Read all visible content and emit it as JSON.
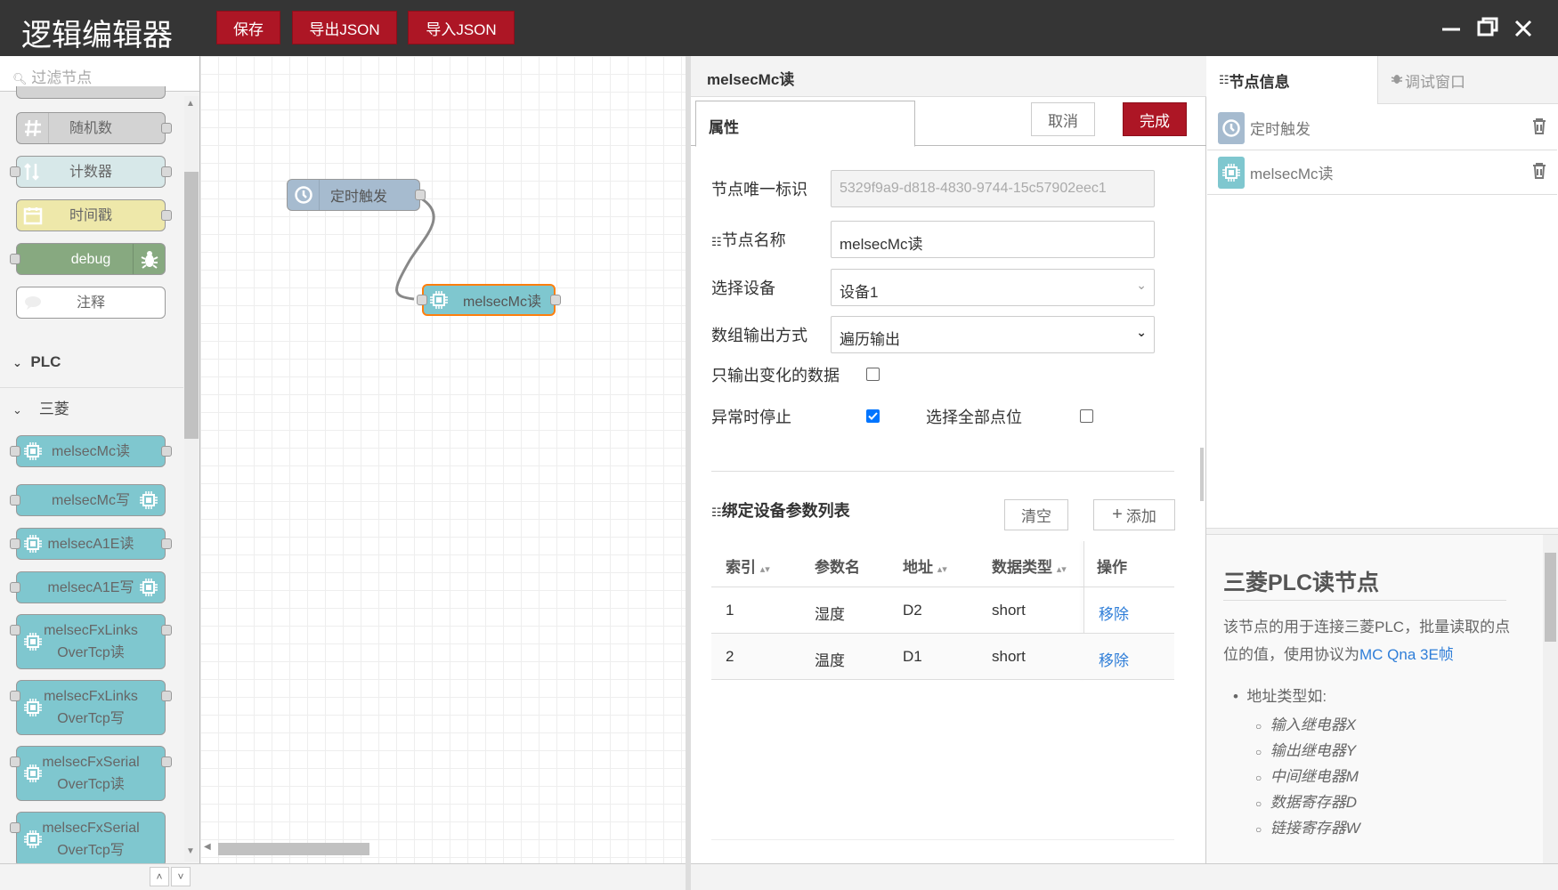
{
  "header": {
    "title": "逻辑编辑器",
    "save_label": "保存",
    "export_label": "导出JSON",
    "import_label": "导入JSON"
  },
  "palette": {
    "filter_placeholder": "过滤节点",
    "common_nodes": [
      {
        "label": "随机数",
        "icon": "hash-icon",
        "color": "#d3d3d3"
      },
      {
        "label": "计数器",
        "icon": "counter-icon",
        "color": "#d7e8e9"
      },
      {
        "label": "时间戳",
        "icon": "calendar-icon",
        "color": "#eee8aa"
      },
      {
        "label": "debug",
        "icon": "bug-icon",
        "color": "#87a980"
      },
      {
        "label": "注释",
        "icon": "comment-icon",
        "color": "#ffffff"
      }
    ],
    "category_plc": "PLC",
    "category_mitsubishi": "三菱",
    "plc_nodes": [
      {
        "line1": "melsecMc读",
        "line2": ""
      },
      {
        "line1": "melsecMc写",
        "line2": ""
      },
      {
        "line1": "melsecA1E读",
        "line2": ""
      },
      {
        "line1": "melsecA1E写",
        "line2": ""
      },
      {
        "line1": "melsecFxLinks",
        "line2": "OverTcp读"
      },
      {
        "line1": "melsecFxLinks",
        "line2": "OverTcp写"
      },
      {
        "line1": "melsecFxSerial",
        "line2": "OverTcp读"
      },
      {
        "line1": "melsecFxSerial",
        "line2": "OverTcp写"
      }
    ],
    "plc_color": "#7fc7cf"
  },
  "flow": {
    "inject_node_label": "定时触发",
    "mc_node_label": "melsecMc读",
    "inject_color": "#a6bbcf",
    "mc_color": "#7fc7cf",
    "selected_border": "#ff7f0e"
  },
  "editor": {
    "tray_title": "melsecMc读",
    "tab_properties": "属性",
    "cancel_label": "取消",
    "done_label": "完成",
    "fields": {
      "node_id_label": "节点唯一标识",
      "node_id_value": "5329f9a9-d818-4830-9744-15c57902eec1",
      "node_name_label": "节点名称",
      "node_name_value": "melsecMc读",
      "device_label": "选择设备",
      "device_value": "设备1",
      "array_output_label": "数组输出方式",
      "array_output_value": "遍历输出",
      "only_changed_label": "只输出变化的数据",
      "only_changed_checked": false,
      "stop_on_error_label": "异常时停止",
      "stop_on_error_checked": true,
      "select_all_label": "选择全部点位",
      "select_all_checked": false
    },
    "bind_section_title": "绑定设备参数列表",
    "clear_label": "清空",
    "add_label": "添加",
    "table": {
      "headers": [
        "索引",
        "参数名",
        "地址",
        "数据类型",
        "操作"
      ],
      "rows": [
        {
          "index": "1",
          "name": "湿度",
          "address": "D2",
          "type": "short",
          "action": "移除"
        },
        {
          "index": "2",
          "name": "温度",
          "address": "D1",
          "type": "short",
          "action": "移除"
        }
      ]
    }
  },
  "sidebar": {
    "tab_info": "节点信息",
    "tab_debug": "调试窗口",
    "nodes": [
      {
        "label": "定时触发",
        "icon": "clock-icon"
      },
      {
        "label": "melsecMc读",
        "icon": "chip-icon"
      }
    ],
    "help": {
      "title": "三菱PLC读节点",
      "desc_prefix": "该节点的用于连接三菱PLC，批量读取的点位的值，使用协议为",
      "desc_link": "MC Qna 3E帧",
      "list_title": "地址类型如:",
      "types": [
        "输入继电器X",
        "输出继电器Y",
        "中间继电器M",
        "数据寄存器D",
        "链接寄存器W"
      ]
    }
  },
  "colors": {
    "header_bg": "#353535",
    "brand_red": "#ad1625",
    "link_blue": "#2f7ed8"
  }
}
